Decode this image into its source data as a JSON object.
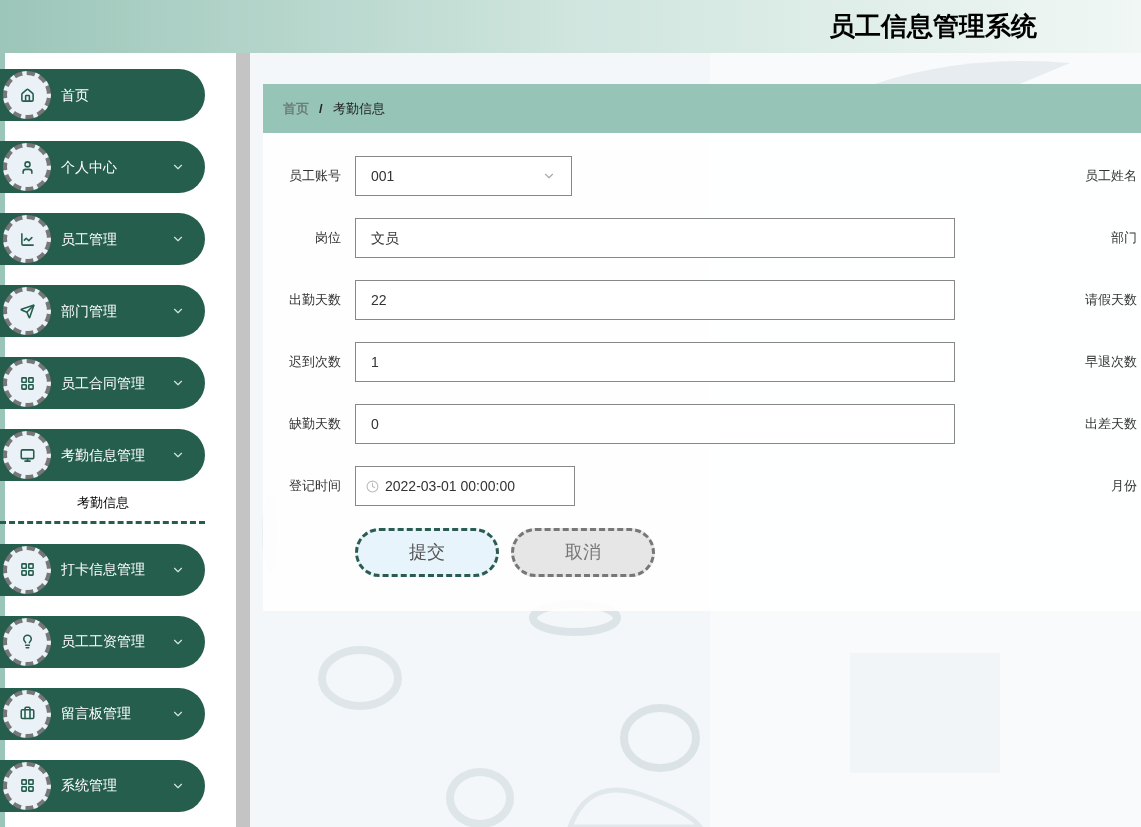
{
  "header": {
    "title": "员工信息管理系统"
  },
  "sidebar": {
    "items": [
      {
        "label": "首页",
        "expandable": false
      },
      {
        "label": "个人中心",
        "expandable": true
      },
      {
        "label": "员工管理",
        "expandable": true
      },
      {
        "label": "部门管理",
        "expandable": true
      },
      {
        "label": "员工合同管理",
        "expandable": true
      },
      {
        "label": "考勤信息管理",
        "expandable": true,
        "children": [
          {
            "label": "考勤信息"
          }
        ]
      },
      {
        "label": "打卡信息管理",
        "expandable": true
      },
      {
        "label": "员工工资管理",
        "expandable": true
      },
      {
        "label": "留言板管理",
        "expandable": true
      },
      {
        "label": "系统管理",
        "expandable": true
      }
    ]
  },
  "breadcrumb": [
    {
      "label": "首页",
      "current": false
    },
    {
      "label": "考勤信息",
      "current": true
    }
  ],
  "breadcrumb_separator": "/",
  "form": {
    "rows": [
      {
        "left": {
          "label": "员工账号",
          "kind": "select",
          "value": "001"
        },
        "right": {
          "label": "员工姓名"
        }
      },
      {
        "left": {
          "label": "岗位",
          "kind": "text",
          "value": "文员"
        },
        "right": {
          "label": "部门"
        }
      },
      {
        "left": {
          "label": "出勤天数",
          "kind": "text",
          "value": "22"
        },
        "right": {
          "label": "请假天数"
        }
      },
      {
        "left": {
          "label": "迟到次数",
          "kind": "text",
          "value": "1"
        },
        "right": {
          "label": "早退次数"
        }
      },
      {
        "left": {
          "label": "缺勤天数",
          "kind": "text",
          "value": "0"
        },
        "right": {
          "label": "出差天数"
        }
      },
      {
        "left": {
          "label": "登记时间",
          "kind": "datetime",
          "value": "2022-03-01 00:00:00"
        },
        "right": {
          "label": "月份"
        }
      }
    ],
    "buttons": [
      {
        "label": "提交",
        "kind": "primary"
      },
      {
        "label": "取消",
        "kind": "secondary"
      }
    ]
  }
}
